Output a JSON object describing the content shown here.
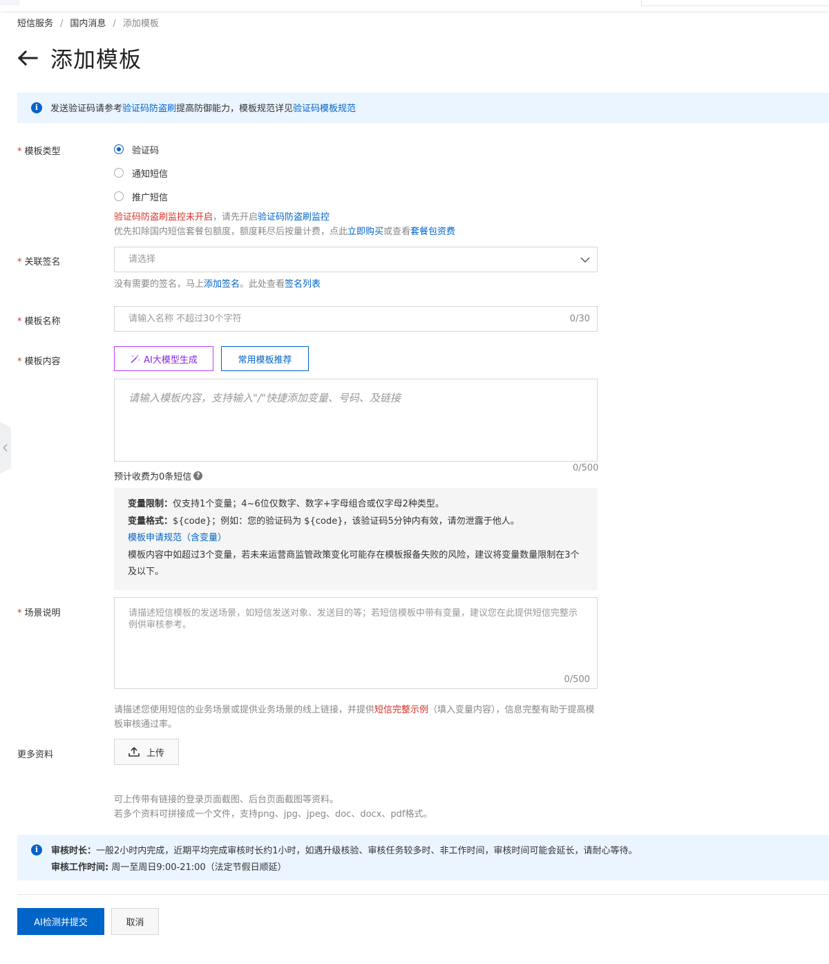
{
  "breadcrumb": [
    "短信服务",
    "国内消息",
    "添加模板"
  ],
  "page": {
    "title": "添加模板"
  },
  "top_notice": {
    "text1": "发送验证码请参考",
    "link1": "验证码防盗刷",
    "text2": "提高防御能力，模板规范详见",
    "link2": "验证码模板规范"
  },
  "template_type": {
    "label": "模板类型",
    "options": [
      "验证码",
      "通知短信",
      "推广短信"
    ],
    "selected": "验证码",
    "warning_red": "验证码防盗刷监控未开启",
    "warning_text": "，请先开启",
    "warning_link": "验证码防盗刷监控",
    "billing_text1": "优先扣除国内短信套餐包额度，额度耗尽后按量计费，点此",
    "billing_link1": "立即购买",
    "billing_text2": "或查看",
    "billing_link2": "套餐包资费"
  },
  "signature": {
    "label": "关联签名",
    "placeholder": "请选择",
    "help_text1": "没有需要的签名，马上",
    "help_link1": "添加签名",
    "help_text2": "。此处查看",
    "help_link2": "签名列表"
  },
  "template_name": {
    "label": "模板名称",
    "placeholder": "请输入名称 不超过30个字符",
    "count": "0/30"
  },
  "template_content": {
    "label": "模板内容",
    "ai_button": "AI大模型生成",
    "common_button": "常用模板推荐",
    "placeholder": "请输入模板内容，支持输入\"/\"快捷添加变量、号码、及链接",
    "count": "0/500",
    "fee": "预计收费为0条短信",
    "rules": {
      "limit_label": "变量限制：",
      "limit_text": "仅支持1个变量；4~6位仅数字、数字+字母组合或仅字母2种类型。",
      "format_label": "变量格式：",
      "format_text": "${code}；例如：您的验证码为 ${code}，该验证码5分钟内有效，请勿泄露于他人。",
      "spec_link": "模板申请规范（含变量）",
      "warning": "模板内容中如超过3个变量，若未来运营商监管政策变化可能存在模板报备失败的风险，建议将变量数量限制在3个及以下。"
    }
  },
  "scene": {
    "label": "场景说明",
    "placeholder": "请描述短信模板的发送场景，如短信发送对象、发送目的等；若短信模板中带有变量，建议您在此提供短信完整示例供审核参考。",
    "count": "0/500",
    "help_text1": "请描述您使用短信的业务场景或提供业务场景的线上链接，并提供",
    "help_red": "短信完整示例",
    "help_text2": "（填入变量内容），信息完整有助于提高模板审核通过率。"
  },
  "more_info": {
    "label": "更多资料",
    "upload_button": "上传",
    "help_line1": "可上传带有链接的登录页面截图、后台页面截图等资料。",
    "help_line2": "若多个资料可拼接成一个文件，支持png、jpg、jpeg、doc、docx、pdf格式。"
  },
  "review_notice": {
    "duration_label": "审核时长：",
    "duration_text": "一般2小时内完成，近期平均完成审核时长约1小时，如遇升级核验、审核任务较多时、非工作时间，审核时间可能会延长，请耐心等待。",
    "hours_label": "审核工作时间:",
    "hours_text": " 周一至周日9:00-21:00（法定节假日顺延）"
  },
  "actions": {
    "submit": "AI检测并提交",
    "cancel": "取消"
  },
  "colors": {
    "primary": "#0064c8",
    "danger": "#d93026",
    "ai": "#8a24e6",
    "notice_bg": "#ebf5ff"
  }
}
